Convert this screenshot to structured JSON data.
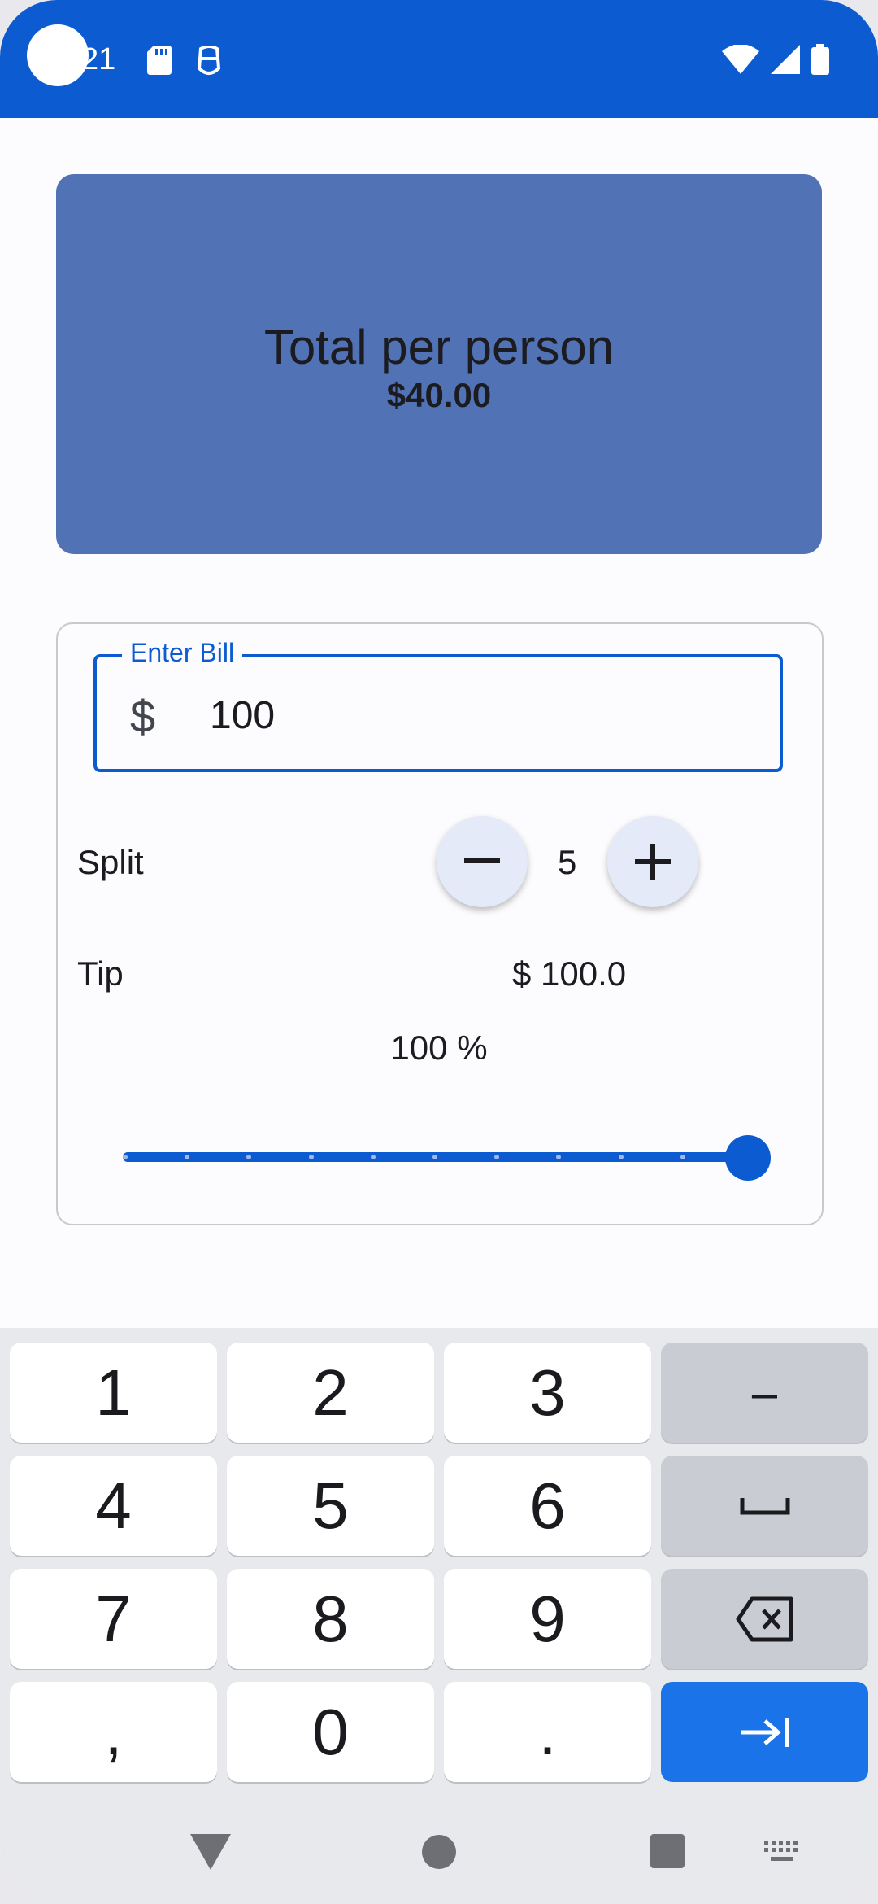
{
  "status_bar": {
    "time": "21",
    "icons": [
      "sd-card-icon",
      "vpn-face-icon",
      "wifi-icon",
      "cell-signal-icon",
      "battery-icon"
    ]
  },
  "total_card": {
    "label": "Total per person",
    "value": "$40.00"
  },
  "bill_input": {
    "label": "Enter Bill",
    "prefix": "$",
    "value": "100"
  },
  "split": {
    "label": "Split",
    "count": "5",
    "decrease_icon": "minus-icon",
    "increase_icon": "plus-icon"
  },
  "tip": {
    "label": "Tip",
    "amount": "$ 100.0",
    "percent_text": "100 %",
    "slider_fraction": 1.0,
    "slider_steps": 10
  },
  "keyboard": {
    "keys": [
      {
        "label": "1"
      },
      {
        "label": "2"
      },
      {
        "label": "3"
      },
      {
        "label": "–"
      },
      {
        "label": "4"
      },
      {
        "label": "5"
      },
      {
        "label": "6"
      },
      {
        "icon": "space-icon"
      },
      {
        "label": "7"
      },
      {
        "label": "8"
      },
      {
        "label": "9"
      },
      {
        "icon": "backspace-icon"
      },
      {
        "label": ","
      },
      {
        "label": "0"
      },
      {
        "label": "."
      },
      {
        "icon": "next-tab-icon"
      }
    ]
  },
  "nav_bar": {
    "icons": [
      "back-icon",
      "home-icon",
      "recents-icon",
      "keyboard-switch-icon"
    ]
  },
  "colors": {
    "primary": "#0c5bd0",
    "card": "#5173b6",
    "enter_key": "#1a73e8"
  }
}
